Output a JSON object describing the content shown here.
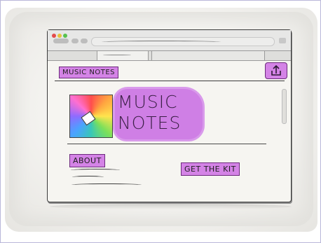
{
  "site": {
    "nav_label": "MUSIC NOTES",
    "title_line1": "MUSIC",
    "title_line2": "NOTES",
    "about_label": "ABOUT",
    "kit_button_label": "GET THE KIT"
  },
  "icons": {
    "share": "share-icon",
    "logo": "color-wheel-logo"
  },
  "colors": {
    "highlight": "#d483e6",
    "close": "#e34b4b",
    "minimize": "#e6c23b",
    "maximize": "#58c24e"
  }
}
